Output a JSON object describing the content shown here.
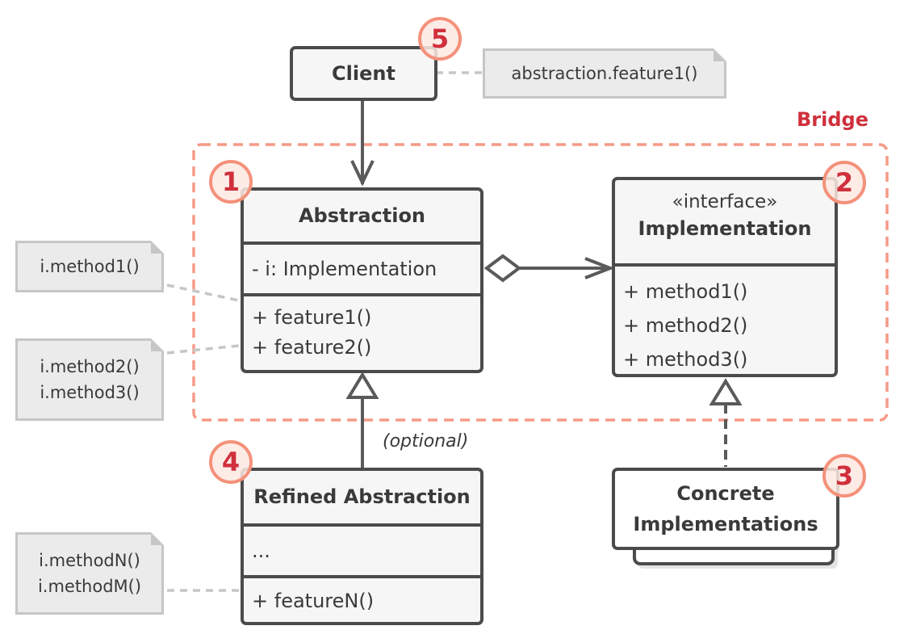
{
  "diagram": {
    "title": "Bridge",
    "colors": {
      "accent": "#d0303c",
      "badge_border": "#f4917a",
      "group_border": "#f59a87",
      "box_border": "#4b4b4b",
      "box_fill": "#f6f6f6",
      "note_fill": "#ebebeb",
      "note_border": "#c6c6c6"
    },
    "client": {
      "name": "Client",
      "badge": "5",
      "note": "abstraction.feature1()"
    },
    "abstraction": {
      "name": "Abstraction",
      "badge": "1",
      "fields": [
        "- i: Implementation"
      ],
      "methods": [
        "+ feature1()",
        "+ feature2()"
      ],
      "notes": [
        {
          "lines": [
            "i.method1()"
          ]
        },
        {
          "lines": [
            "i.method2()",
            "i.method3()"
          ]
        }
      ]
    },
    "implementation": {
      "stereotype": "«interface»",
      "name": "Implementation",
      "badge": "2",
      "methods": [
        "+ method1()",
        "+ method2()",
        "+ method3()"
      ]
    },
    "concrete": {
      "name_lines": [
        "Concrete",
        "Implementations"
      ],
      "badge": "3"
    },
    "refined": {
      "name": "Refined Abstraction",
      "badge": "4",
      "fields": [
        "..."
      ],
      "methods": [
        "+ featureN()"
      ],
      "note": {
        "lines": [
          "i.methodN()",
          "i.methodM()"
        ]
      },
      "inheritance_label": "(optional)"
    },
    "relations": [
      {
        "from": "Client",
        "to": "Abstraction",
        "type": "association"
      },
      {
        "from": "Abstraction",
        "to": "Implementation",
        "type": "aggregation"
      },
      {
        "from": "Refined Abstraction",
        "to": "Abstraction",
        "type": "inheritance"
      },
      {
        "from": "Concrete Implementations",
        "to": "Implementation",
        "type": "realization"
      }
    ]
  }
}
